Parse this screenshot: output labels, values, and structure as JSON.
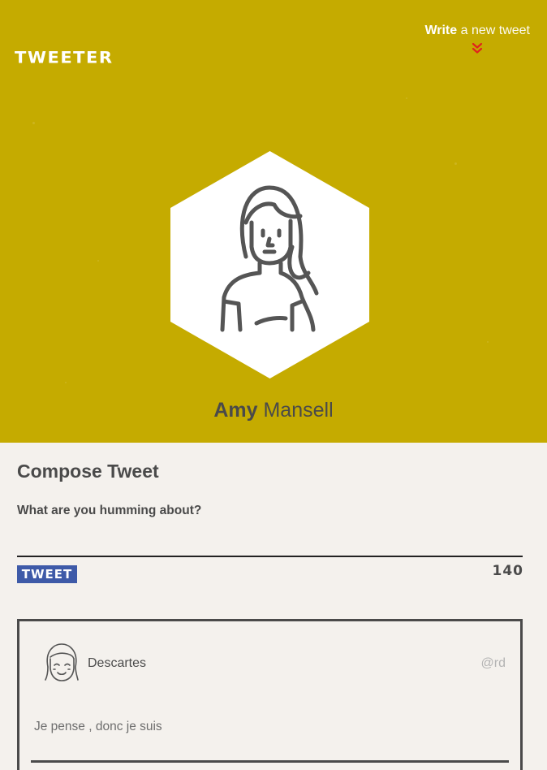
{
  "header": {
    "brand": "TWEETER",
    "write_bold": "Write",
    "write_rest": "a new tweet"
  },
  "profile": {
    "first_name": "Amy",
    "last_name": "Mansell"
  },
  "compose": {
    "title": "Compose Tweet",
    "label": "What are you humming about?",
    "input_value": "",
    "button_label": "TWEET",
    "char_count": "140"
  },
  "tweet": {
    "author": "Descartes",
    "handle": "@rd",
    "text": "Je pense , donc je suis"
  },
  "colors": {
    "hero_background": "#c5ab00",
    "button_background": "#3e5aa8",
    "chevron": "#e0241d",
    "page_background": "#f4f1ed",
    "text_dark": "#4a4a4a"
  },
  "icons": {
    "write_indicator": "double-chevron-down-icon",
    "profile": "woman-avatar-icon",
    "tweet_author": "smiling-face-avatar-icon",
    "tweet_actions": [
      "flag-icon",
      "heart-icon"
    ]
  }
}
